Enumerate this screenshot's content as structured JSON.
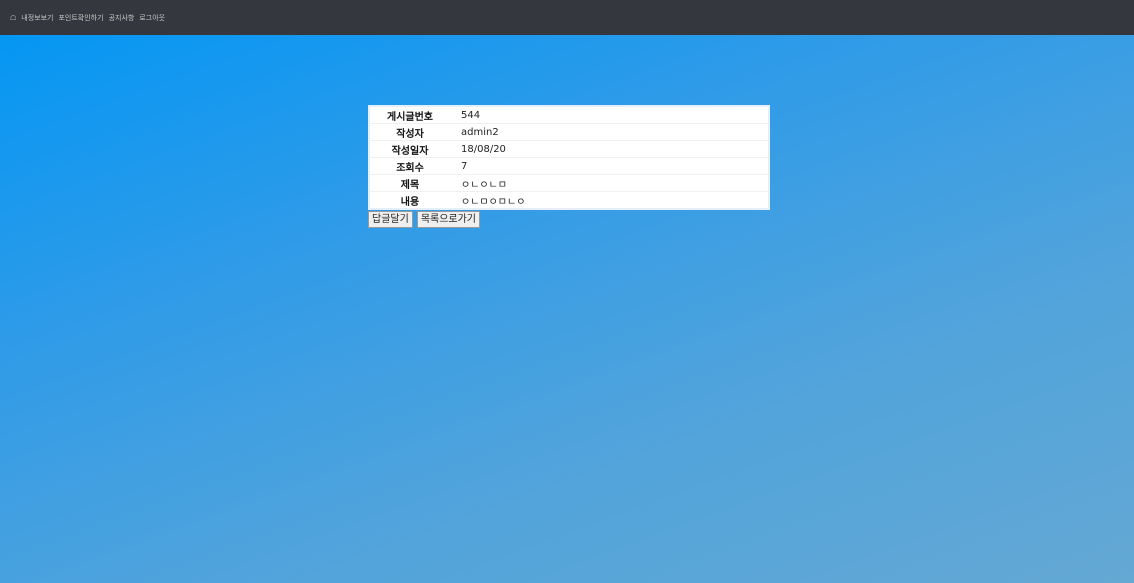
{
  "topbar": {
    "home_icon": "home-icon",
    "items": [
      {
        "label": "내정보보기"
      },
      {
        "label": "포인트확인하기"
      },
      {
        "label": "공지사항"
      },
      {
        "label": "로그아웃"
      }
    ]
  },
  "post": {
    "rows": [
      {
        "label": "게시글번호",
        "value": "544"
      },
      {
        "label": "작성자",
        "value": "admin2"
      },
      {
        "label": "작성일자",
        "value": "18/08/20"
      },
      {
        "label": "조회수",
        "value": "7"
      },
      {
        "label": "제목",
        "value": "ㅇㄴㅇㄴㅁ"
      },
      {
        "label": "내용",
        "value": "ㅇㄴㅁㅇㅁㄴㅇ"
      }
    ]
  },
  "buttons": {
    "reply": "답글달기",
    "list": "목록으로가기"
  }
}
